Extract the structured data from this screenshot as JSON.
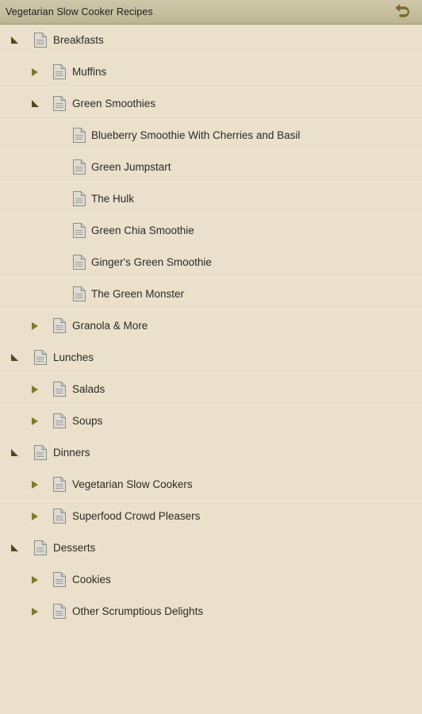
{
  "titlebar": {
    "title": "Vegetarian Slow Cooker Recipes",
    "back_icon": "undo-back-arrow-icon",
    "background_color": "#c5be9f",
    "text_color": "#1d1d1b"
  },
  "theme": {
    "page_background": "#ebe0cb",
    "separator_color": "#efe7d5",
    "label_color": "#2b2b26",
    "triangle_collapsed_color": "#7d7a2e",
    "triangle_expanded_color": "#4e4c1a",
    "doc_icon_color": "#d9d9d3",
    "doc_icon_border": "#8f8f88"
  },
  "tree": {
    "icon_name": "document-icon",
    "items": [
      {
        "label": "Breakfasts",
        "depth": 1,
        "state": "expanded"
      },
      {
        "label": "Muffins",
        "depth": 2,
        "state": "collapsed"
      },
      {
        "label": "Green Smoothies",
        "depth": 2,
        "state": "expanded"
      },
      {
        "label": "Blueberry Smoothie With Cherries and Basil",
        "depth": 3,
        "state": "leaf"
      },
      {
        "label": "Green Jumpstart",
        "depth": 3,
        "state": "leaf"
      },
      {
        "label": "The Hulk",
        "depth": 3,
        "state": "leaf"
      },
      {
        "label": "Green Chia Smoothie",
        "depth": 3,
        "state": "leaf"
      },
      {
        "label": "Ginger's Green Smoothie",
        "depth": 3,
        "state": "leaf"
      },
      {
        "label": "The Green Monster",
        "depth": 3,
        "state": "leaf"
      },
      {
        "label": "Granola & More",
        "depth": 2,
        "state": "collapsed"
      },
      {
        "label": "Lunches",
        "depth": 1,
        "state": "expanded"
      },
      {
        "label": "Salads",
        "depth": 2,
        "state": "collapsed"
      },
      {
        "label": "Soups",
        "depth": 2,
        "state": "collapsed"
      },
      {
        "label": "Dinners",
        "depth": 1,
        "state": "expanded"
      },
      {
        "label": "Vegetarian Slow Cookers",
        "depth": 2,
        "state": "collapsed"
      },
      {
        "label": "Superfood Crowd Pleasers",
        "depth": 2,
        "state": "collapsed"
      },
      {
        "label": "Desserts",
        "depth": 1,
        "state": "expanded"
      },
      {
        "label": "Cookies",
        "depth": 2,
        "state": "collapsed"
      },
      {
        "label": "Other Scrumptious Delights",
        "depth": 2,
        "state": "collapsed"
      }
    ]
  }
}
